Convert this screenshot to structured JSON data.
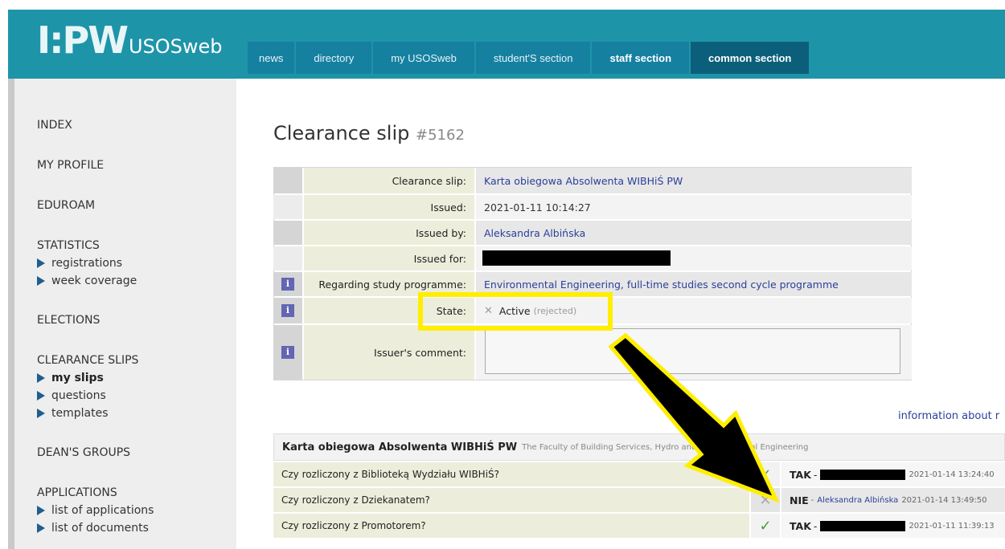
{
  "header": {
    "logo_mark": "I:PW",
    "logo_text": "USOSweb",
    "tabs": [
      {
        "label": "news"
      },
      {
        "label": "directory"
      },
      {
        "label": "my USOSweb"
      },
      {
        "label": "student'S section"
      },
      {
        "label": "staff section"
      },
      {
        "label": "common section"
      }
    ]
  },
  "sidebar": {
    "index": "INDEX",
    "my_profile": "MY PROFILE",
    "eduroam": "EDUROAM",
    "statistics": "STATISTICS",
    "registrations": "registrations",
    "week_coverage": "week coverage",
    "elections": "ELECTIONS",
    "clearance_slips": "CLEARANCE SLIPS",
    "my_slips": "my slips",
    "questions": "questions",
    "templates": "templates",
    "deans_groups": "DEAN'S GROUPS",
    "applications": "APPLICATIONS",
    "list_of_applications": "list of applications",
    "list_of_documents": "list of documents"
  },
  "page": {
    "title": "Clearance slip",
    "number": "#5162"
  },
  "details": {
    "clearance_slip_label": "Clearance slip:",
    "clearance_slip_value": "Karta obiegowa Absolwenta WIBHiŚ PW",
    "issued_label": "Issued:",
    "issued_value": "2021-01-11 10:14:27",
    "issued_by_label": "Issued by:",
    "issued_by_value": "Aleksandra Albińska",
    "issued_for_label": "Issued for:",
    "regarding_label": "Regarding study programme:",
    "regarding_value": "Environmental Engineering, full-time studies second cycle programme",
    "state_label": "State:",
    "state_value": "Active",
    "state_note": "(rejected)",
    "comment_label": "Issuer's comment:"
  },
  "info_link": "information about r",
  "checklist": {
    "title": "Karta obiegowa Absolwenta WIBHiŚ PW",
    "faculty": "The Faculty of Building Services, Hydro and Environmental Engineering",
    "rows": [
      {
        "question": "Czy rozliczony z Biblioteką Wydziału WIBHiŚ?",
        "answer": "TAK",
        "sep": "-",
        "who": "",
        "date": "2021-01-14 13:24:40"
      },
      {
        "question": "Czy rozliczony z Dziekanatem?",
        "answer": "NIE",
        "sep": "-",
        "who": "Aleksandra Albińska",
        "date": "2021-01-14 13:49:50"
      },
      {
        "question": "Czy rozliczony z Promotorem?",
        "answer": "TAK",
        "sep": "-",
        "who": "",
        "date": "2021-01-11 11:39:13"
      }
    ]
  },
  "colors": {
    "header": "#1e94a9",
    "highlight": "#ffee00",
    "link": "#2a3f9a"
  }
}
